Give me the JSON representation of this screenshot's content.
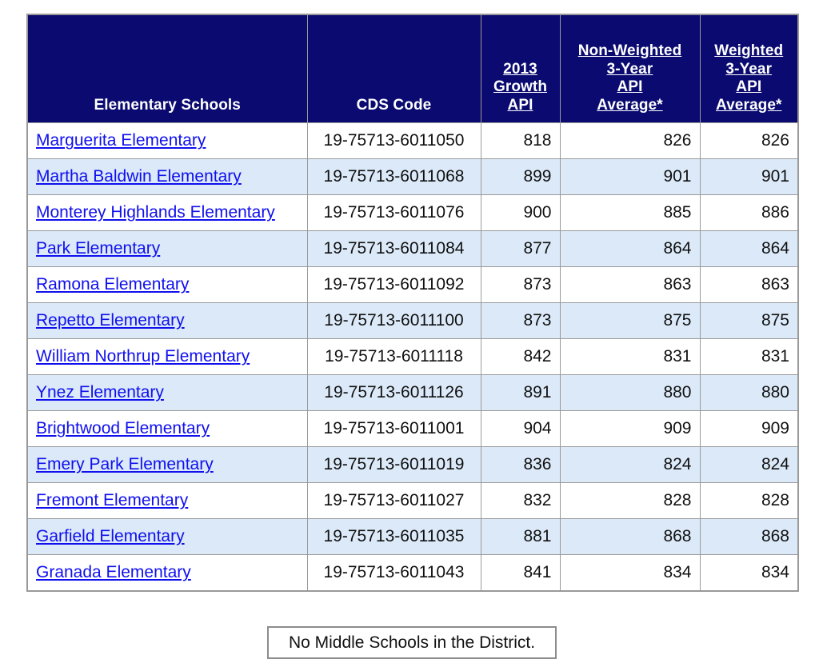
{
  "table": {
    "columns": [
      {
        "key": "school",
        "label": "Elementary Schools",
        "underlined": false,
        "align": "center"
      },
      {
        "key": "cds",
        "label": "CDS Code",
        "underlined": false,
        "align": "center"
      },
      {
        "key": "growth",
        "label": "2013\nGrowth\nAPI",
        "underlined": true,
        "align": "center"
      },
      {
        "key": "nonwt",
        "label": "Non-Weighted\n3-Year\nAPI\nAverage*",
        "underlined": true,
        "align": "center"
      },
      {
        "key": "wt",
        "label": "Weighted\n3-Year\nAPI\nAverage*",
        "underlined": true,
        "align": "center"
      }
    ],
    "headers": {
      "school": "Elementary Schools",
      "cds": "CDS Code",
      "growth_l1": "2013",
      "growth_l2": "Growth",
      "growth_l3": "API",
      "nonwt_l1": "Non-Weighted",
      "nonwt_l2": "3-Year",
      "nonwt_l3": "API",
      "nonwt_l4": "Average*",
      "wt_l1": "Weighted",
      "wt_l2": "3-Year",
      "wt_l3": "API",
      "wt_l4": "Average*"
    },
    "rows": [
      {
        "school": "Marguerita Elementary",
        "cds": "19-75713-6011050",
        "growth": "818",
        "nonwt": "826",
        "wt": "826",
        "stripe": "white"
      },
      {
        "school": "Martha Baldwin Elementary",
        "cds": "19-75713-6011068",
        "growth": "899",
        "nonwt": "901",
        "wt": "901",
        "stripe": "blue"
      },
      {
        "school": "Monterey Highlands Elementary",
        "cds": "19-75713-6011076",
        "growth": "900",
        "nonwt": "885",
        "wt": "886",
        "stripe": "white"
      },
      {
        "school": "Park Elementary",
        "cds": "19-75713-6011084",
        "growth": "877",
        "nonwt": "864",
        "wt": "864",
        "stripe": "blue"
      },
      {
        "school": "Ramona Elementary",
        "cds": "19-75713-6011092",
        "growth": "873",
        "nonwt": "863",
        "wt": "863",
        "stripe": "white"
      },
      {
        "school": "Repetto Elementary",
        "cds": "19-75713-6011100",
        "growth": "873",
        "nonwt": "875",
        "wt": "875",
        "stripe": "blue"
      },
      {
        "school": "William Northrup Elementary",
        "cds": "19-75713-6011118",
        "growth": "842",
        "nonwt": "831",
        "wt": "831",
        "stripe": "white"
      },
      {
        "school": "Ynez Elementary",
        "cds": "19-75713-6011126",
        "growth": "891",
        "nonwt": "880",
        "wt": "880",
        "stripe": "blue"
      },
      {
        "school": "Brightwood Elementary",
        "cds": "19-75713-6011001",
        "growth": "904",
        "nonwt": "909",
        "wt": "909",
        "stripe": "white"
      },
      {
        "school": "Emery Park Elementary",
        "cds": "19-75713-6011019",
        "growth": "836",
        "nonwt": "824",
        "wt": "824",
        "stripe": "blue"
      },
      {
        "school": "Fremont Elementary",
        "cds": "19-75713-6011027",
        "growth": "832",
        "nonwt": "828",
        "wt": "828",
        "stripe": "white"
      },
      {
        "school": "Garfield Elementary",
        "cds": "19-75713-6011035",
        "growth": "881",
        "nonwt": "868",
        "wt": "868",
        "stripe": "blue"
      },
      {
        "school": "Granada Elementary",
        "cds": "19-75713-6011043",
        "growth": "841",
        "nonwt": "834",
        "wt": "834",
        "stripe": "white"
      }
    ]
  },
  "note": {
    "text": "No Middle Schools in the District."
  },
  "colors": {
    "header_background": "#0a0a70",
    "header_text": "#ffffff",
    "row_stripe": "#dbe9f8",
    "row_default": "#ffffff",
    "link": "#1010ee",
    "border": "#9a9a9a",
    "body_text": "#111111"
  }
}
